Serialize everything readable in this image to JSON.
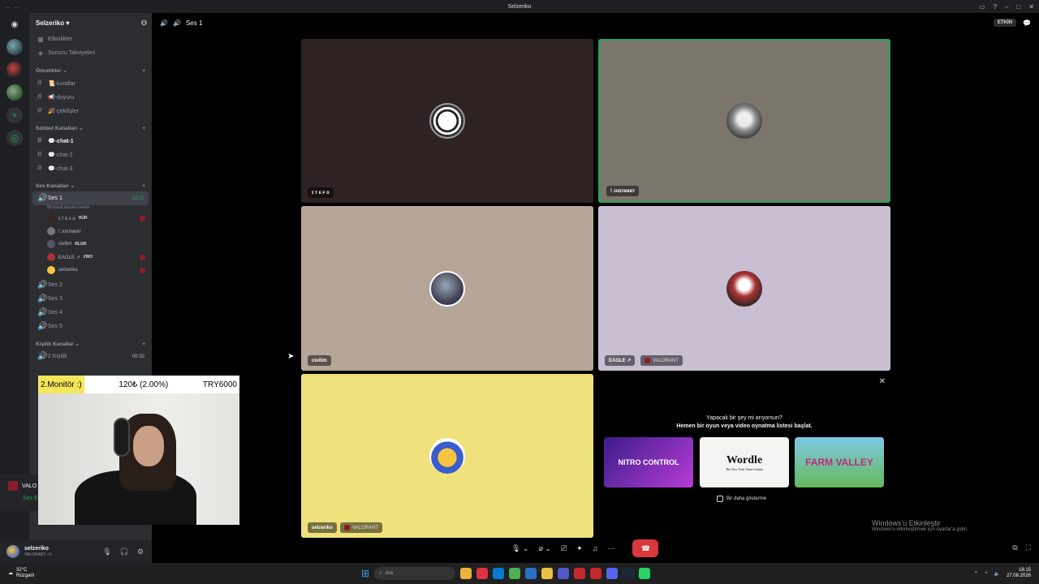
{
  "window": {
    "title": "Selzeriko"
  },
  "server": {
    "name": "Selzeriko",
    "top_items": [
      "Etkinlikler",
      "Sunucu Takviyeleri"
    ],
    "categories": [
      {
        "name": "Öncelikler",
        "channels": [
          "📜-kurallar",
          "📢-duyuru",
          "🎉-çekilişler"
        ]
      },
      {
        "name": "Sohbet Kanalları",
        "channels": [
          "💬-chat-1",
          "💬-chat-2",
          "💬-chat-3"
        ]
      },
      {
        "name": "Ses Kanalları"
      },
      {
        "name": "Kişilik Kanallar"
      }
    ],
    "voice_active": {
      "name": "Ses 1",
      "timer": "32:22",
      "status_hint": "Bir kanal durumu belirle",
      "users": [
        {
          "name": "ɪ ᴛ ᴇ ꜰ ᴏ",
          "tag": "HÜR"
        },
        {
          "name": "! ᴊᴜꜱᴛᴍᴇʀᴛ",
          "tag": ""
        },
        {
          "name": "civilim",
          "tag": "RLGR"
        },
        {
          "name": "EAGLE ↗",
          "tag": "//WO"
        },
        {
          "name": "selzeriko",
          "tag": ""
        }
      ]
    },
    "voice_other": [
      "Ses 2",
      "Ses 3",
      "Ses 4",
      "Ses 5"
    ],
    "personal": {
      "name": "2 Kişilik",
      "count_a": "00",
      "count_b": "02"
    }
  },
  "voice_status": {
    "game": "VALO",
    "channel": "Ses E"
  },
  "user": {
    "name": "selzeriko",
    "status": "VALORANT +1"
  },
  "cam_overlay": {
    "monitor": "2.Monitör :)",
    "amount": "120₺ (2.00%)",
    "goal": "TRY6000"
  },
  "main": {
    "channel": "Ses 1",
    "etkin": "ETKİN"
  },
  "tiles": [
    {
      "name": "ɪ ᴛ ᴇ ꜰ ᴏ",
      "game": ""
    },
    {
      "name": "! ᴊᴜꜱᴛᴍᴇʀᴛ",
      "game": ""
    },
    {
      "name": "civilim",
      "game": ""
    },
    {
      "name": "EAGLE ↗",
      "game": "VALORANT"
    },
    {
      "name": "selzeriko",
      "game": "VALORANT"
    }
  ],
  "activity": {
    "line1": "Yapacak bir şey mi arıyorsun?",
    "line2": "Hemen bir oyun veya video oynatma listesi başlat.",
    "cards": [
      "NITRO CONTROL",
      "Wordle",
      "FARM VALLEY"
    ],
    "wordle_sub": "The New York Times Games",
    "dont_show": "Bir daha gösterme"
  },
  "watermark": {
    "line1": "Windows'u Etkinleştir",
    "line2": "Windows'u etkinleştirmek için Ayarlar'a gidin."
  },
  "taskbar": {
    "temp": "32°C",
    "weather": "Rüzgarlı",
    "search": "Ara",
    "time": "18:15",
    "date": "27.08.2026"
  }
}
